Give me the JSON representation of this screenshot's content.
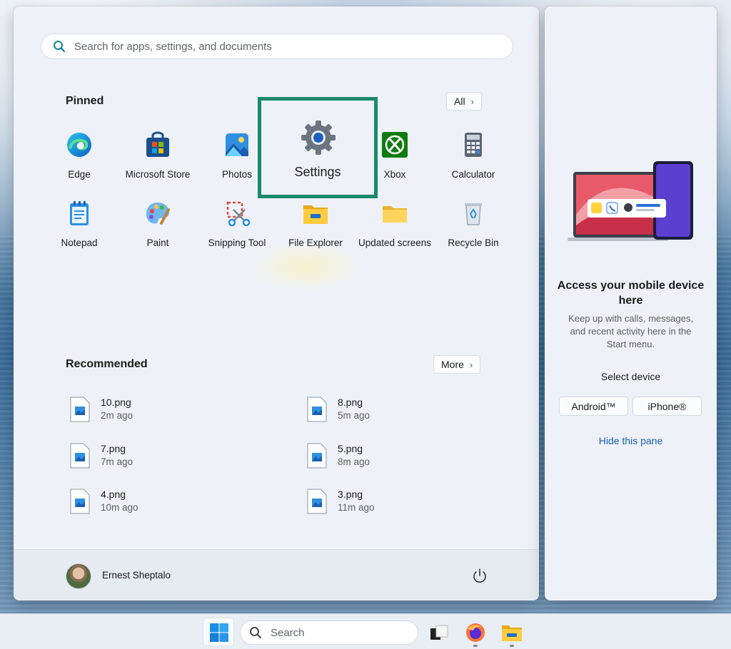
{
  "search": {
    "placeholder": "Search for apps, settings, and documents"
  },
  "pinned": {
    "title": "Pinned",
    "all_label": "All",
    "apps": [
      {
        "label": "Edge",
        "icon": "edge-icon"
      },
      {
        "label": "Microsoft Store",
        "icon": "store-icon"
      },
      {
        "label": "Photos",
        "icon": "photos-icon"
      },
      {
        "label": "Settings",
        "icon": "gear-icon"
      },
      {
        "label": "Xbox",
        "icon": "xbox-icon"
      },
      {
        "label": "Calculator",
        "icon": "calculator-icon"
      },
      {
        "label": "Notepad",
        "icon": "notepad-icon"
      },
      {
        "label": "Paint",
        "icon": "paint-icon"
      },
      {
        "label": "Snipping Tool",
        "icon": "scissors-icon"
      },
      {
        "label": "File Explorer",
        "icon": "folder-icon"
      },
      {
        "label": "Updated screens",
        "icon": "folder-icon"
      },
      {
        "label": "Recycle Bin",
        "icon": "recycle-bin-icon"
      }
    ]
  },
  "recommended": {
    "title": "Recommended",
    "more_label": "More",
    "items": [
      {
        "name": "10.png",
        "time": "2m ago"
      },
      {
        "name": "8.png",
        "time": "5m ago"
      },
      {
        "name": "7.png",
        "time": "7m ago"
      },
      {
        "name": "5.png",
        "time": "8m ago"
      },
      {
        "name": "4.png",
        "time": "10m ago"
      },
      {
        "name": "3.png",
        "time": "11m ago"
      }
    ]
  },
  "user": {
    "name": "Ernest Sheptalo"
  },
  "side_pane": {
    "title": "Access your mobile device here",
    "description": "Keep up with calls, messages, and recent activity here in the Start menu.",
    "select_label": "Select device",
    "android_label": "Android™",
    "iphone_label": "iPhone®",
    "hide_label": "Hide this pane"
  },
  "taskbar": {
    "search_label": "Search"
  },
  "colors": {
    "highlight": "#1a8a6a",
    "link": "#1a5fb4",
    "accent": "#0067c0"
  }
}
